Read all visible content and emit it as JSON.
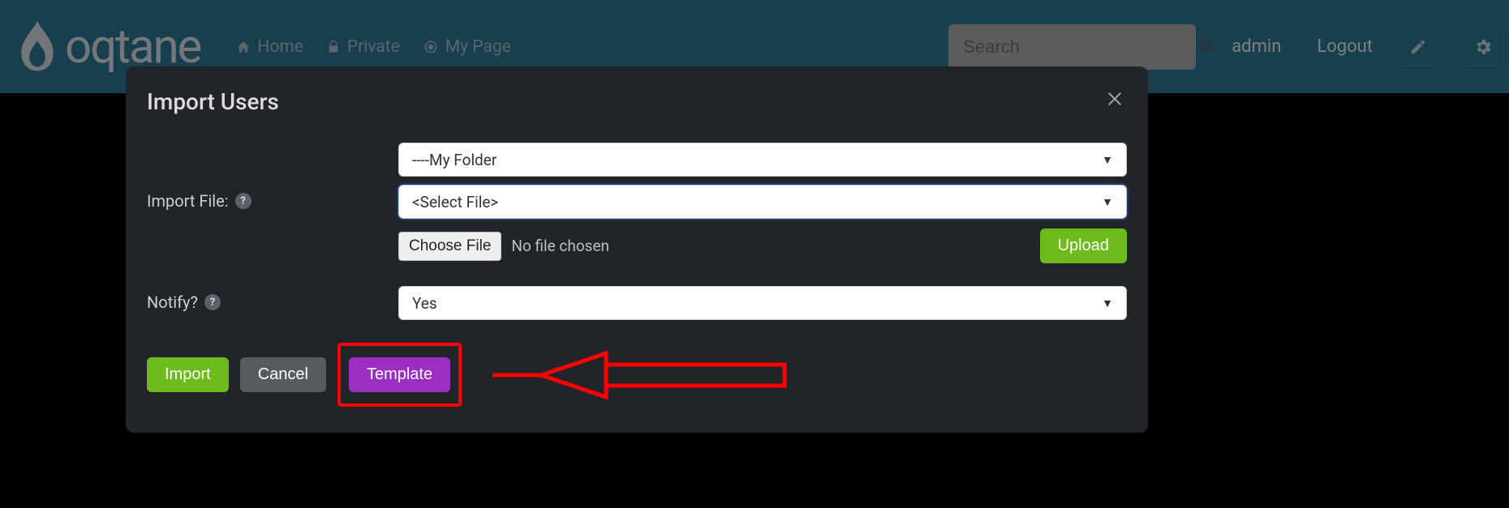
{
  "brand": {
    "name": "oqtane"
  },
  "nav": [
    {
      "label": "Home",
      "icon": "home-icon"
    },
    {
      "label": "Private",
      "icon": "lock-icon"
    },
    {
      "label": "My Page",
      "icon": "target-icon"
    }
  ],
  "search": {
    "placeholder": "Search"
  },
  "session": {
    "user": "admin",
    "logout_label": "Logout"
  },
  "modal": {
    "title": "Import Users",
    "import_file_label": "Import File:",
    "folder_select": "----My Folder",
    "file_select": "<Select File>",
    "choose_file_label": "Choose File",
    "no_file_text": "No file chosen",
    "upload_label": "Upload",
    "notify_label": "Notify?",
    "notify_value": "Yes",
    "actions": {
      "import": "Import",
      "cancel": "Cancel",
      "template": "Template"
    }
  }
}
